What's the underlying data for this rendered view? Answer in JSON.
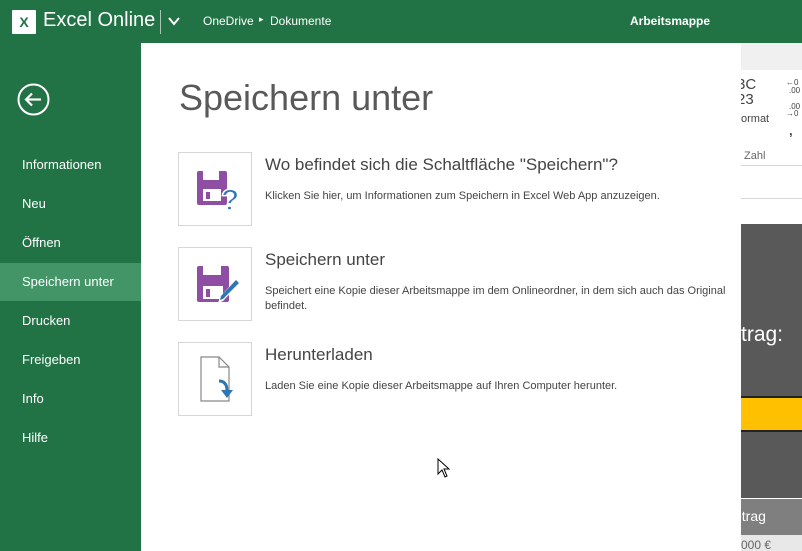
{
  "header": {
    "app_logo": "X",
    "app_name": "Excel Online",
    "breadcrumb": [
      "OneDrive",
      "Dokumente"
    ],
    "breadcrumb_separator": "▸",
    "document_title": "Arbeitsmappe"
  },
  "sidebar": {
    "items": [
      {
        "label": "Informationen",
        "active": false
      },
      {
        "label": "Neu",
        "active": false
      },
      {
        "label": "Öffnen",
        "active": false
      },
      {
        "label": "Speichern unter",
        "active": true
      },
      {
        "label": "Drucken",
        "active": false
      },
      {
        "label": "Freigeben",
        "active": false
      },
      {
        "label": "Info",
        "active": false
      },
      {
        "label": "Hilfe",
        "active": false
      }
    ]
  },
  "main": {
    "title": "Speichern unter",
    "options": [
      {
        "icon": "save-help-icon",
        "title": "Wo befindet sich die Schaltfläche \"Speichern\"?",
        "description": "Klicken Sie hier, um Informationen zum Speichern in Excel Web App anzuzeigen."
      },
      {
        "icon": "save-as-icon",
        "title": "Speichern unter",
        "description": "Speichert eine Kopie dieser Arbeitsmappe im dem Onlineordner, in dem sich auch das Original befindet."
      },
      {
        "icon": "download-icon",
        "title": "Herunterladen",
        "description": "Laden Sie eine Kopie dieser Arbeitsmappe auf Ihren Computer herunter."
      }
    ]
  },
  "background_peek": {
    "ribbon_text_1": "3C",
    "ribbon_text_2": "23",
    "ribbon_text_3": "ormat",
    "ribbon_text_4": "Zahl",
    "ribbon_small_1": "←0",
    "ribbon_small_2": ".00",
    "ribbon_small_3": ".00",
    "ribbon_small_4": "→0",
    "ribbon_comma": ",",
    "cell_big_text": "trag:",
    "header_cell_text": "etrag",
    "value_cell_text": "000 €"
  },
  "colors": {
    "brand_green": "#217346",
    "active_nav": "#439467",
    "icon_purple": "#8e4ea4",
    "icon_blue": "#2e75b6"
  }
}
